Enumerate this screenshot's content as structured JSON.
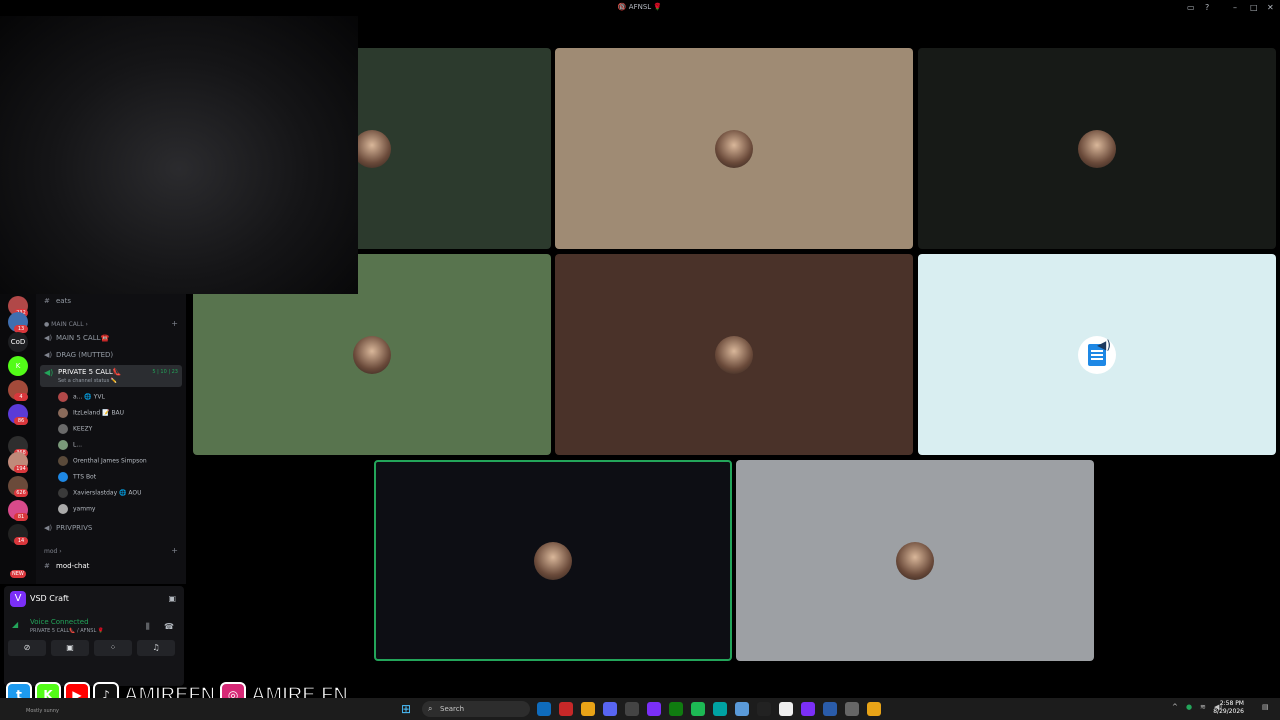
{
  "window": {
    "title": "🔞 AFNSL 🌹"
  },
  "rail": {
    "servers": [
      {
        "label": "",
        "badge": "232",
        "color": "#b14848"
      },
      {
        "label": "",
        "badge": "13",
        "color": "#3f6fb0"
      },
      {
        "label": "CoD",
        "badge": "",
        "color": "#1e1f22"
      },
      {
        "label": "K",
        "badge": "",
        "color": "#53fc18"
      },
      {
        "label": "",
        "badge": "4",
        "color": "#a34a3a"
      },
      {
        "label": "",
        "badge": "86",
        "color": "#5b3bd8"
      },
      {
        "label": "",
        "badge": "368",
        "color": "#2e2e2e"
      },
      {
        "label": "",
        "badge": "194",
        "color": "#c08a7a"
      },
      {
        "label": "",
        "badge": "626",
        "color": "#6a4a3a"
      },
      {
        "label": "",
        "badge": "81",
        "color": "#d84a8a"
      },
      {
        "label": "",
        "badge": "14",
        "color": "#222"
      }
    ],
    "new_badge": "NEW"
  },
  "sidebar": {
    "top_channel": "eats",
    "category_main": "MAIN CALL",
    "main5": "MAIN 5 CALL☎️",
    "drag": "DRAG (MUTTED)",
    "active": {
      "name": "PRIVATE 5 CALL👠",
      "status": "Set a channel status ✏️",
      "count": "5 | 10 | 23"
    },
    "members": [
      {
        "name": "a... 🌐 YVL",
        "color": "#b14848"
      },
      {
        "name": "ItzLeland 📝 BAU",
        "color": "#8a6a5a"
      },
      {
        "name": "KEEZY",
        "color": "#6a6a6a"
      },
      {
        "name": "L...",
        "color": "#7a9a7a"
      },
      {
        "name": "Orenthal James Simpson",
        "color": "#5a4a3a"
      },
      {
        "name": "TTS Bot",
        "color": "#1e88e5"
      },
      {
        "name": "Xavierslastday 🌐 AOU",
        "color": "#3a3a3a"
      },
      {
        "name": "yammy",
        "color": "#aaa"
      }
    ],
    "privprivs": "PRIVPRIVS",
    "category_mod": "mod",
    "mod_chat": "mod-chat"
  },
  "panel": {
    "app_name": "VSD Craft",
    "voice_title": "Voice Connected",
    "voice_sub": "PRIVATE 5 CALL👠 / AFNSL 🌹"
  },
  "tiles": [
    {
      "bg": "#2c3a2d",
      "speaking": false,
      "kind": "avatar"
    },
    {
      "bg": "#9f8b74",
      "speaking": false,
      "kind": "avatar"
    },
    {
      "bg": "#171a17",
      "speaking": false,
      "kind": "avatar"
    },
    {
      "bg": "#58744e",
      "speaking": false,
      "kind": "avatar"
    },
    {
      "bg": "#4a3229",
      "speaking": false,
      "kind": "avatar"
    },
    {
      "bg": "#d9eef1",
      "speaking": false,
      "kind": "doc"
    },
    {
      "bg": "#0d0e14",
      "speaking": true,
      "kind": "avatar"
    },
    {
      "bg": "#9da0a4",
      "speaking": false,
      "kind": "avatar"
    }
  ],
  "social": {
    "handle_kick": "AMIREFN",
    "handle_ig": "AMIRE.FN",
    "colors": {
      "twitter": "#1d9bf0",
      "kick": "#53fc18",
      "youtube": "#ff0000",
      "tiktok": "#111111",
      "instagram": "#d62976"
    }
  },
  "taskbar": {
    "search_placeholder": "Search",
    "time": "2:58 PM",
    "date": "8/29/2026",
    "weather_text": "Mostly sunny"
  }
}
